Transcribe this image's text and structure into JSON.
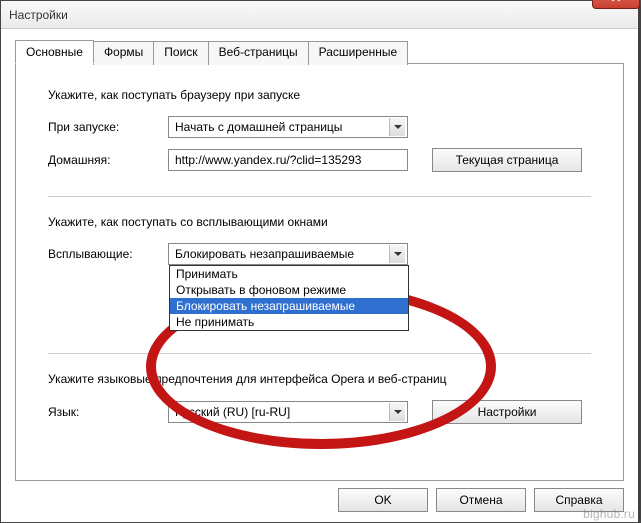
{
  "window": {
    "title": "Настройки",
    "close_glyph": "✕"
  },
  "tabs": {
    "t0": "Основные",
    "t1": "Формы",
    "t2": "Поиск",
    "t3": "Веб-страницы",
    "t4": "Расширенные"
  },
  "startup": {
    "section": "Укажите, как поступать браузеру при запуске",
    "on_start_label": "При запуске:",
    "on_start_value": "Начать с домашней страницы",
    "home_label": "Домашняя:",
    "home_value": "http://www.yandex.ru/?clid=135293",
    "current_page_btn": "Текущая страница"
  },
  "popups": {
    "section": "Укажите, как поступать со всплывающими окнами",
    "label": "Всплывающие:",
    "value": "Блокировать незапрашиваемые",
    "options": {
      "o0": "Принимать",
      "o1": "Открывать в фоновом режиме",
      "o2": "Блокировать незапрашиваемые",
      "o3": "Не принимать"
    }
  },
  "lang": {
    "section": "Укажите языковые предпочтения для интерфейса Opera и веб-страниц",
    "label": "Язык:",
    "value": "Русский (RU) [ru-RU]",
    "settings_btn": "Настройки"
  },
  "buttons": {
    "ok": "OK",
    "cancel": "Отмена",
    "help": "Справка"
  },
  "watermark": "bighub.ru"
}
